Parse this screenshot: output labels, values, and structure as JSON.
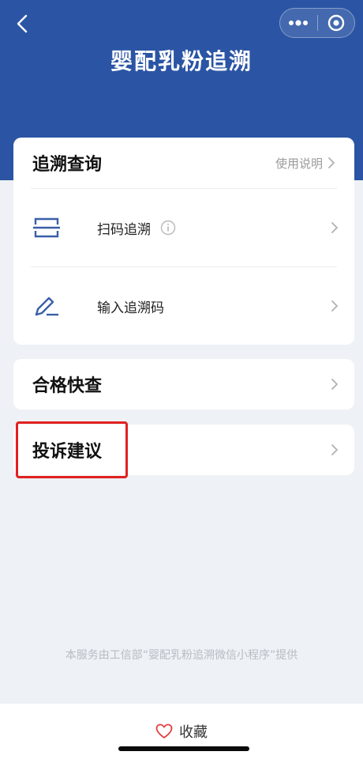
{
  "header": {
    "title": "婴配乳粉追溯",
    "back_icon": "chevron-left-icon",
    "more_icon": "more-dots-icon",
    "close_icon": "target-circle-icon",
    "background_color": "#2b55a4"
  },
  "trace_card": {
    "title": "追溯查询",
    "help_link": "使用说明",
    "items": [
      {
        "label": "扫码追溯",
        "icon": "scan-icon",
        "has_info": true
      },
      {
        "label": "输入追溯码",
        "icon": "pen-icon",
        "has_info": false
      }
    ]
  },
  "qualified_card": {
    "title": "合格快查"
  },
  "complaint_card": {
    "title": "投诉建议",
    "highlight_color": "#e0211f"
  },
  "footer": {
    "note": "本服务由工信部“婴配乳粉追溯微信小程序”提供"
  },
  "bottom_bar": {
    "collect_label": "收藏",
    "collect_icon": "heart-icon"
  }
}
